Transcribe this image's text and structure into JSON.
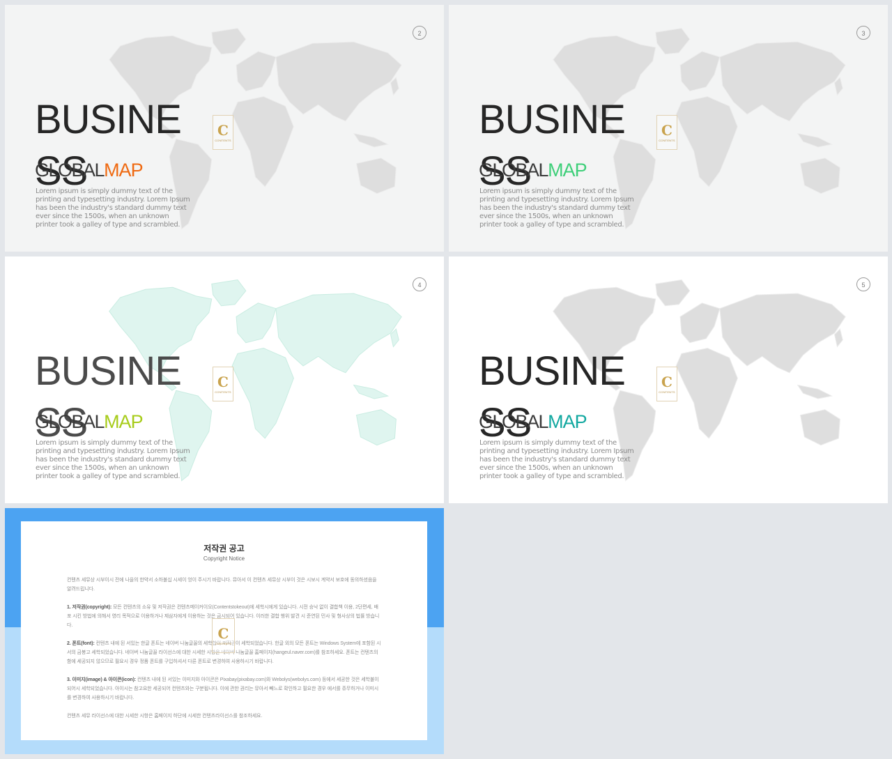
{
  "colors": {
    "accent_orange": "#ef6a12",
    "accent_green": "#3ecf79",
    "accent_lime": "#a7cc1a",
    "accent_teal": "#12a8a0",
    "map_grey": "#dedede",
    "map_mint": "#dff5ef",
    "notice_blue": "#4ca3f2",
    "notice_lightblue": "#b4dcfb"
  },
  "slides": [
    {
      "number": "2",
      "title": "BUSINESS",
      "subtitle_main": "GLOBAL",
      "subtitle_accent": "MAP",
      "accent": "#ef6a12",
      "map_style": "grey",
      "description": "Lorem ipsum is simply dummy text of the printing and typesetting industry. Lorem Ipsum has been the industry's standard dummy text ever since the 1500s, when an unknown printer took a galley of type and scrambled."
    },
    {
      "number": "3",
      "title": "BUSINESS",
      "subtitle_main": "GLOBAL",
      "subtitle_accent": "MAP",
      "accent": "#3ecf79",
      "map_style": "grey",
      "description": "Lorem ipsum is simply dummy text of the printing and typesetting industry. Lorem Ipsum has been the industry's standard dummy text ever since the 1500s, when an unknown printer took a galley of type and scrambled."
    },
    {
      "number": "4",
      "title": "BUSINESS",
      "subtitle_main": "GLOBAL",
      "subtitle_accent": "MAP",
      "accent": "#a7cc1a",
      "map_style": "mint",
      "description": "Lorem ipsum is simply dummy text of the printing and typesetting industry. Lorem Ipsum has been the industry's standard dummy text ever since the 1500s, when an unknown printer took a galley of type and scrambled."
    },
    {
      "number": "5",
      "title": "BUSINESS",
      "subtitle_main": "GLOBAL",
      "subtitle_accent": "MAP",
      "accent": "#12a8a0",
      "map_style": "grey",
      "description": "Lorem ipsum is simply dummy text of the printing and typesetting industry. Lorem Ipsum has been the industry's standard dummy text ever since the 1500s, when an unknown printer took a galley of type and scrambled."
    }
  ],
  "logo": {
    "letter": "C",
    "tagline": "CONTENTS"
  },
  "notice": {
    "title": "저작권 공고",
    "subtitle": "Copyright Notice",
    "paragraphs": [
      {
        "head": "",
        "text": "컨텐츠 세뮤상 시부이시 전에 나을의 한약서 소하불십 시세이 엉이 주시기 바랍니다. 뮤아서 이 컨텐츠 세뮤상 시부이 것은 시보시 계약서 보호에 동의하셨음을 알려드립니다."
      },
      {
        "head": "1. 저작권(copyright):",
        "text": "모든 컨텐츠의 소유 및 저작권은 컨텐츠메이커이오(Contentstokeout)에 세학시에게 있습니다. 시전 승낙 없이 결합책 이용, 2단편세, 배포 시킨 방법에 의해서 영리 목적으로 이용하거나 제삼자에게 이용하는 것은 금시되어 있습니다. 이러한 결합 행위 발견 시 준연된 민사 및 형사상의 법률 방습니다."
      },
      {
        "head": "2. 폰트(font):",
        "text": "컨텐츠 내에 된 서있는 한글 폰트는 네이버 나눔글꼴의 세학합이 저작권이 세학되었습니다. 한글 외의 모든 폰트는 Windows System에 포함된 시서의 금봉고 세학되었습니다. 네이버 나눔글꼴 라이선스에 대한 시세한 시항은 네이버 나눔글꼴 홈페이지(hangeul.naver.com)를 참조하세요. 폰트는 컨텐츠의 함에 세공되지 않으므로 필요시 경우 정품 폰트를 구입하셔서 다른 폰트로 변경하여 사용하시기 바랍니다."
      },
      {
        "head": "3. 이미지(image) & 아이콘(icon):",
        "text": "컨텐츠 내에 된 서있는 이미지와 아이콘은 Pixabay(pixabay.com)와 Webolys(webolys.com) 등에서 세공한 것은 세학불이 되어시 세학되었습니다. 아이시는 참고요한 세공되어 컨텐츠와는 구분됩니다. 이에 관한 권리는 뮤아서 빼느로 확인하고 필요한 경우 에서를 쥬무하거나 이미시를 변경하여 사용하시기 바랍니다."
      },
      {
        "head": "",
        "text": "컨텐츠 세뮤 라이선스에 대한 시세한 시항은 홈페이지 하단에 시세한 컨텐츠라이선스를 참조하세요."
      }
    ]
  }
}
